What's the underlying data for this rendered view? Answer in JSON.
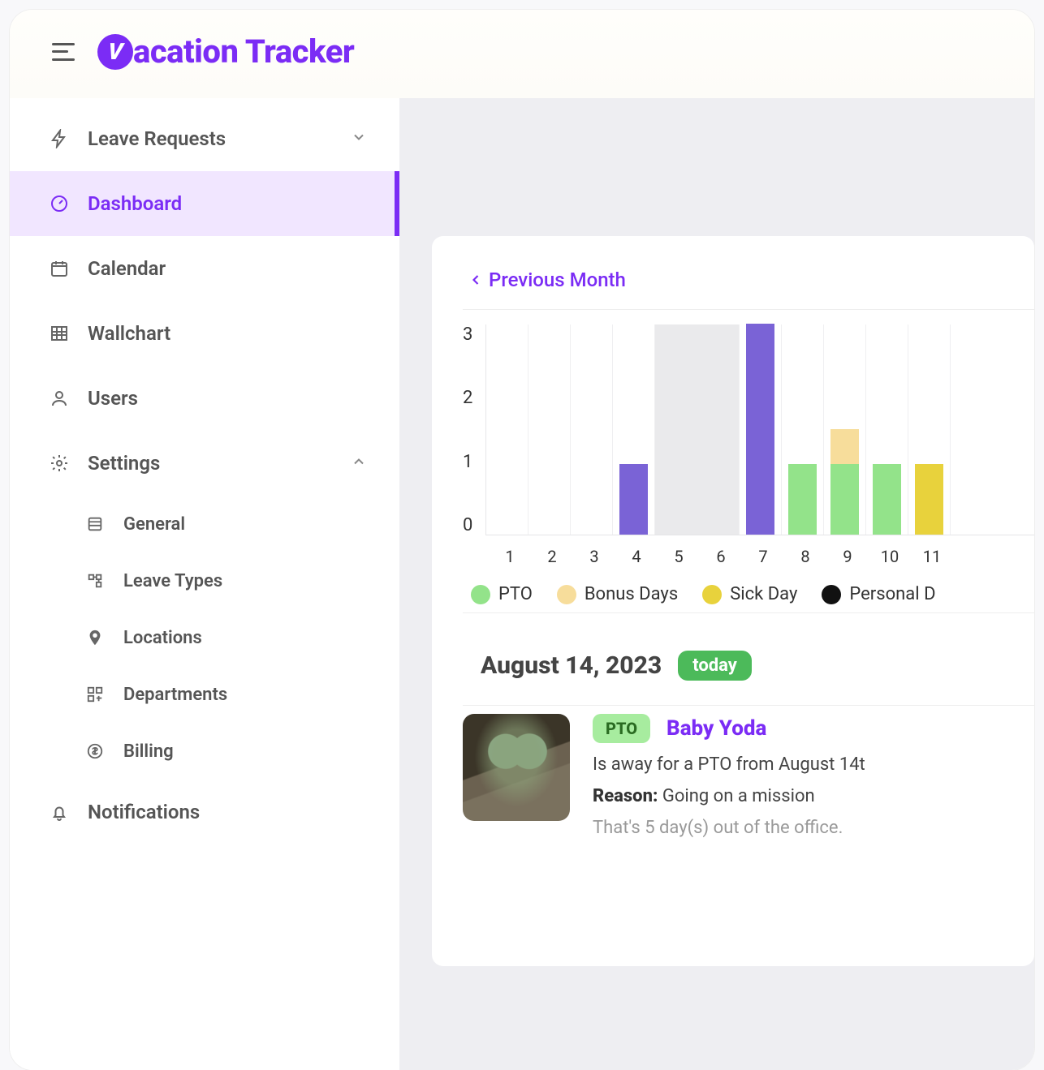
{
  "app": {
    "title": "acation Tracker"
  },
  "sidebar": {
    "items": [
      {
        "label": "Leave Requests",
        "expandable": true
      },
      {
        "label": "Dashboard"
      },
      {
        "label": "Calendar"
      },
      {
        "label": "Wallchart"
      },
      {
        "label": "Users"
      },
      {
        "label": "Settings",
        "expandable": true,
        "expanded": true
      },
      {
        "label": "Notifications"
      }
    ],
    "settings_children": [
      {
        "label": "General"
      },
      {
        "label": "Leave Types"
      },
      {
        "label": "Locations"
      },
      {
        "label": "Departments"
      },
      {
        "label": "Billing"
      }
    ]
  },
  "main": {
    "prev_month_label": "Previous Month",
    "date_heading": "August 14, 2023",
    "today_badge": "today"
  },
  "legend": [
    {
      "label": "PTO",
      "color": "#93e38a"
    },
    {
      "label": "Bonus Days",
      "color": "#f7dd9b"
    },
    {
      "label": "Sick Day",
      "color": "#e8d23c"
    },
    {
      "label": "Personal D",
      "color": "#111111"
    }
  ],
  "entry": {
    "badge": "PTO",
    "person": "Baby Yoda",
    "away_line": "Is away for a PTO from August 14t",
    "reason_label": "Reason:",
    "reason_text": "Going on a mission",
    "summary": "That's 5 day(s) out of the office."
  },
  "chart_data": {
    "type": "bar",
    "ylabel": "",
    "xlabel": "",
    "ylim": [
      0,
      3
    ],
    "y_ticks": [
      0,
      1,
      2,
      3
    ],
    "categories": [
      "1",
      "2",
      "3",
      "4",
      "5",
      "6",
      "7",
      "8",
      "9",
      "10",
      "11"
    ],
    "weekend_columns": [
      5,
      6
    ],
    "series": [
      {
        "name": "PTO",
        "color": "#93e38a",
        "values": [
          0,
          0,
          0,
          0,
          0,
          0,
          0,
          1,
          1,
          1,
          0
        ]
      },
      {
        "name": "Bonus Days",
        "color": "#f7dd9b",
        "values": [
          0,
          0,
          0,
          0,
          0,
          0,
          0,
          0,
          0.5,
          0,
          0
        ]
      },
      {
        "name": "Sick Day",
        "color": "#e8d23c",
        "values": [
          0,
          0,
          0,
          0,
          0,
          0,
          0,
          0,
          0,
          0,
          1
        ]
      },
      {
        "name": "Unlabeled",
        "color": "#7a63d6",
        "values": [
          0,
          0,
          0,
          1,
          0,
          0,
          3,
          0,
          0,
          0,
          0
        ]
      }
    ]
  }
}
